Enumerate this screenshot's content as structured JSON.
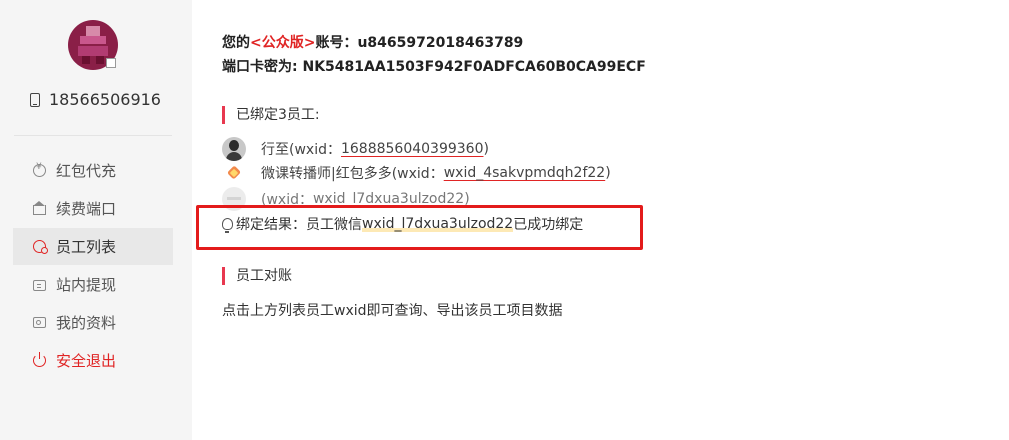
{
  "sidebar": {
    "phone": "18566506916",
    "menu": [
      {
        "label": "红包代充",
        "icon": "coin-icon"
      },
      {
        "label": "续费端口",
        "icon": "crown-icon"
      },
      {
        "label": "员工列表",
        "icon": "staff-icon",
        "active": true
      },
      {
        "label": "站内提现",
        "icon": "ticket-icon"
      },
      {
        "label": "我的资料",
        "icon": "id-card-icon"
      },
      {
        "label": "安全退出",
        "icon": "power-icon"
      }
    ]
  },
  "account": {
    "prefix": "您的",
    "version": "<公众版>",
    "account_label": "账号：",
    "account_id": "u8465972018463789",
    "port_key_label": "端口卡密为: ",
    "port_key": "NK5481AA1503F942F0ADFCA60B0CA99ECF"
  },
  "bound_section": {
    "title": "已绑定3员工:",
    "employees": [
      {
        "name": "行至",
        "wxid_prefix": "(wxid：",
        "wxid": "1688856040399360",
        "suffix": ")"
      },
      {
        "name": "微课转播师|红包多多",
        "wxid_prefix": "(wxid：",
        "wxid": "wxid_4sakvpmdqh2f22",
        "suffix": ")"
      },
      {
        "name": "",
        "wxid_prefix": "(wxid：",
        "wxid": "wxid_l7dxua3ulzod22",
        "suffix": ")"
      }
    ]
  },
  "bind_result": {
    "prefix": "绑定结果：员工微信",
    "wxid": "wxid_l7dxua3ulzod22",
    "suffix": "已成功绑定"
  },
  "reconcile": {
    "title": "员工对账",
    "description": "点击上方列表员工wxid即可查询、导出该员工项目数据"
  },
  "colors": {
    "accent_red": "#e02424",
    "highlight_box": "#e31b1b",
    "sidebar_bg": "#f5f5f5"
  }
}
